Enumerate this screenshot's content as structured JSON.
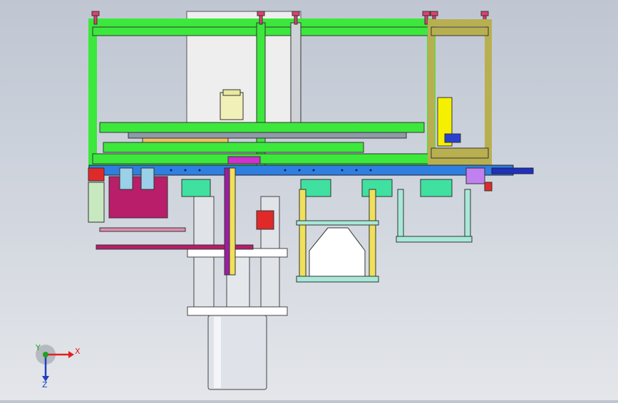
{
  "viewport": {
    "background_top": "#bfc6d2",
    "background_bottom": "#e4e6ea"
  },
  "triad": {
    "x_label": "X",
    "y_label": "Y",
    "z_label": "Z",
    "x_color": "#e02020",
    "y_color": "#20a020",
    "z_color": "#2040c0"
  },
  "colors": {
    "frame_green": "#3ce83c",
    "frame_olive": "#b8b050",
    "rail_blue": "#2f7fe0",
    "cylinder_grey": "#dde0e6",
    "magenta": "#c82f8c",
    "cyan_stand": "#a8e8d8",
    "yellow_post": "#f0e05a",
    "red_block": "#e02a2a"
  }
}
